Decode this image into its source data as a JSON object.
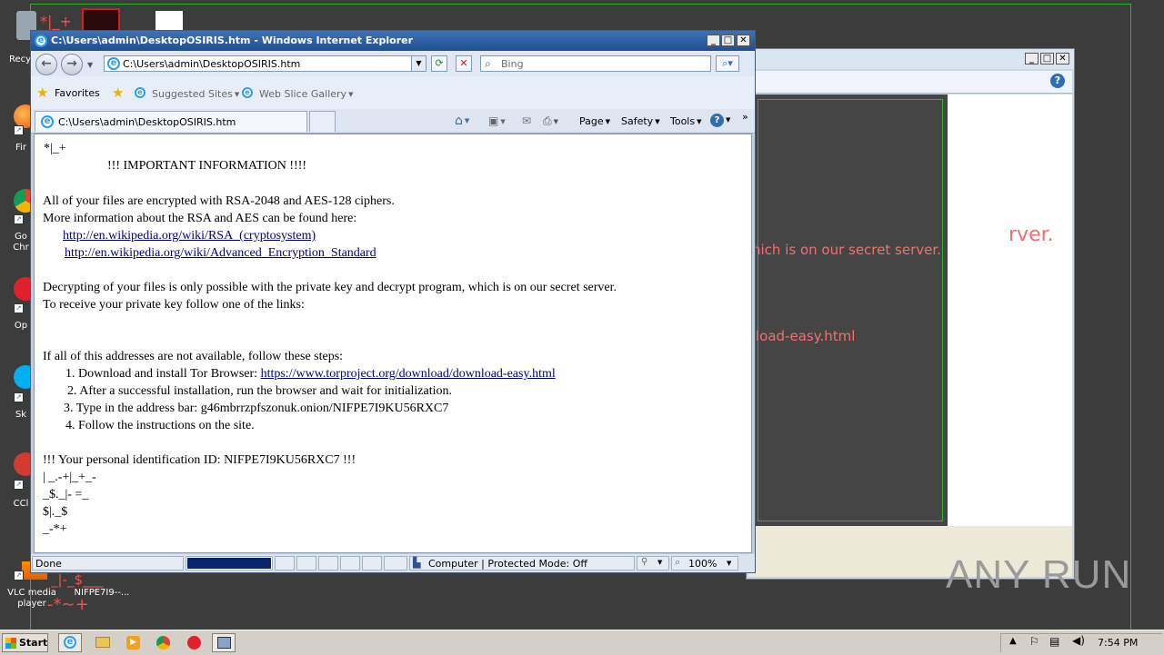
{
  "desktop": {
    "icons": [
      {
        "label": "Recy",
        "icon": "recycle-bin-icon"
      },
      {
        "label": "Fir",
        "icon": "firefox-icon"
      },
      {
        "label": "Go\nChr",
        "icon": "chrome-icon"
      },
      {
        "label": "Op",
        "icon": "opera-icon"
      },
      {
        "label": "Sk",
        "icon": "skype-icon"
      },
      {
        "label": "CCl",
        "icon": "ccleaner-icon"
      },
      {
        "label": "VLC media\nplayer",
        "icon": "vlc-icon"
      },
      {
        "label": "NIFPE7I9--...",
        "icon": "file-icon"
      }
    ],
    "scribbles": [
      "*|_+",
      "_|-_$___",
      "-*~+"
    ]
  },
  "bg_window": {
    "text_server": "hich is on our secret server.",
    "text_server_large": "rver.",
    "text_download": "load-easy.html"
  },
  "ie": {
    "title": "C:\\Users\\admin\\DesktopOSIRIS.htm - Windows Internet Explorer",
    "address": "C:\\Users\\admin\\DesktopOSIRIS.htm",
    "search_placeholder": "Bing",
    "favorites_label": "Favorites",
    "suggested_sites": "Suggested Sites",
    "web_slice_gallery": "Web Slice Gallery",
    "tab_title": "C:\\Users\\admin\\DesktopOSIRIS.htm",
    "cmd_page": "Page",
    "cmd_safety": "Safety",
    "cmd_tools": "Tools",
    "status_text": "Done",
    "status_zone": "Computer | Protected Mode: Off",
    "zoom": "100%",
    "progress": 1.0
  },
  "document": {
    "lines": [
      {
        "text": "*|_+"
      },
      {
        "text": "!!! IMPORTANT INFORMATION !!!!"
      },
      {
        "text": "All  of  your  files  are  encrypted  with  RSA-2048  and  AES-128  ciphers."
      },
      {
        "text": "More  information  about  the  RSA  and  AES  can  be  found  here:"
      },
      {
        "text": "http://en.wikipedia.org/wiki/RSA_(cryptosystem)",
        "link": true
      },
      {
        "text": "http://en.wikipedia.org/wiki/Advanced_Encryption_Standard",
        "link": true
      },
      {
        "text": "Decrypting  of your  files is  only  possible with  the  private  key  and decrypt  program,  which  is on  our secret  server."
      },
      {
        "text": "To receive  your  private key follow one  of  the  links:"
      },
      {
        "text": "If  all  of this  addresses are  not  available, follow these  steps:"
      },
      {
        "text": "1.  Download and install Tor Browser: "
      },
      {
        "text": "https://www.torproject.org/download/download-easy.html",
        "link": true
      },
      {
        "text": "2.  After  a successful installation,  run  the  browser and wait for initialization."
      },
      {
        "text": "3. Type  in the address bar: g46mbrrzpfszonuk.onion/NIFPE7I9KU56RXC7"
      },
      {
        "text": "4.  Follow the instructions on the site."
      },
      {
        "text": "!!!  Your personal identification ID: NIFPE7I9KU56RXC7 !!!"
      },
      {
        "text": "| _.-+|_+_-"
      },
      {
        "text": "_$._|- =_"
      },
      {
        "text": "$|._$"
      },
      {
        "text": "_-*+"
      }
    ]
  },
  "taskbar": {
    "start_label": "Start",
    "clock": "7:54 PM"
  },
  "watermark": "ANY RUN",
  "colors": {
    "desktop_bg": "#3c3c3c",
    "accent_green": "#2db52d",
    "ransom_text_red": "#f07070",
    "link_color": "#00007a",
    "progress_fill": "#0a246a"
  }
}
